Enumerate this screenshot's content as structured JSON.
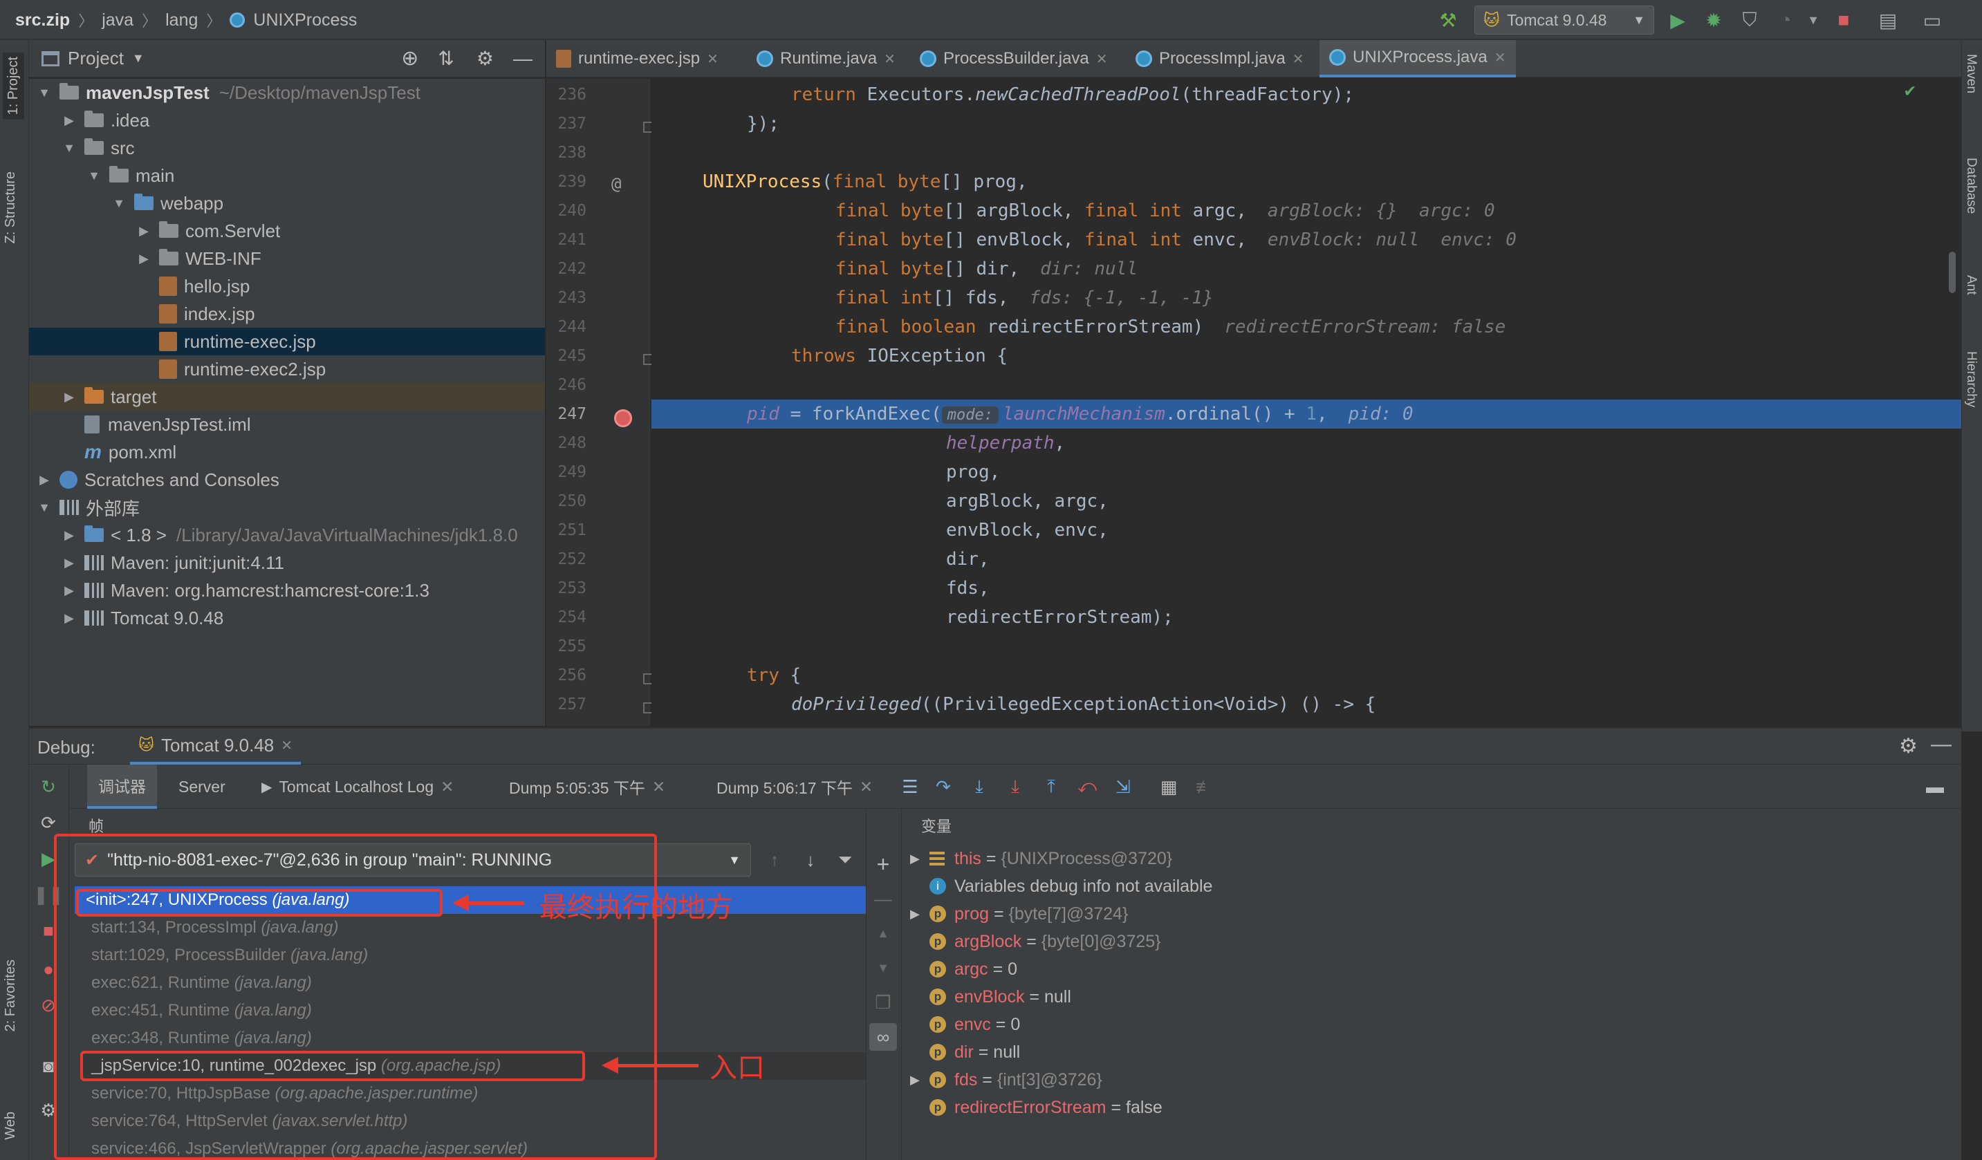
{
  "breadcrumbs": [
    "src.zip",
    "java",
    "lang",
    "UNIXProcess"
  ],
  "run_config": "Tomcat 9.0.48",
  "left_strip": {
    "project_tab": "1: Project",
    "structure_tab": "Z: Structure",
    "favorites_tab": "2: Favorites",
    "web_tab": "Web"
  },
  "right_strip": [
    "Maven",
    "Database",
    "Ant",
    "Hierarchy"
  ],
  "project": {
    "title": "Project",
    "tree": [
      {
        "label": "mavenJspTest",
        "path": "~/Desktop/mavenJspTest"
      },
      {
        "label": ".idea"
      },
      {
        "label": "src"
      },
      {
        "label": "main"
      },
      {
        "label": "webapp"
      },
      {
        "label": "com.Servlet"
      },
      {
        "label": "WEB-INF"
      },
      {
        "label": "hello.jsp"
      },
      {
        "label": "index.jsp"
      },
      {
        "label": "runtime-exec.jsp"
      },
      {
        "label": "runtime-exec2.jsp"
      },
      {
        "label": "target"
      },
      {
        "label": "mavenJspTest.iml"
      },
      {
        "label": "pom.xml"
      },
      {
        "label": "Scratches and Consoles"
      },
      {
        "label": "外部库"
      },
      {
        "label": "< 1.8 >",
        "path": "/Library/Java/JavaVirtualMachines/jdk1.8.0"
      },
      {
        "label": "Maven: junit:junit:4.11"
      },
      {
        "label": "Maven: org.hamcrest:hamcrest-core:1.3"
      },
      {
        "label": "Tomcat 9.0.48"
      }
    ]
  },
  "editor": {
    "tabs": [
      "runtime-exec.jsp",
      "Runtime.java",
      "ProcessBuilder.java",
      "ProcessImpl.java",
      "UNIXProcess.java"
    ],
    "active_tab": "UNIXProcess.java",
    "line_numbers": [
      "236",
      "237",
      "238",
      "239",
      "240",
      "241",
      "242",
      "243",
      "244",
      "245",
      "246",
      "247",
      "248",
      "249",
      "250",
      "251",
      "252",
      "253",
      "254",
      "255",
      "256",
      "257"
    ],
    "code": {
      "l236_kw": "return ",
      "l236_a": "Executors.",
      "l236_b": "newCachedThreadPool",
      "l236_c": "(threadFactory);",
      "l237": "});",
      "l239_fn": "UNIXProcess",
      "l239_a": "(",
      "l239_kw1": "final ",
      "l239_kw2": "byte",
      "l239_b": "[] prog,",
      "l240_kw1": "final ",
      "l240_kw2": "byte",
      "l240_a": "[] argBlock, ",
      "l240_kw3": "final ",
      "l240_kw4": "int",
      "l240_b": " argc,",
      "l240_hint": "argBlock: {}  argc: 0",
      "l241_kw1": "final ",
      "l241_kw2": "byte",
      "l241_a": "[] envBlock, ",
      "l241_kw3": "final ",
      "l241_kw4": "int",
      "l241_b": " envc,",
      "l241_hint": "envBlock: null  envc: 0",
      "l242_kw1": "final ",
      "l242_kw2": "byte",
      "l242_a": "[] dir,",
      "l242_hint": "dir: null",
      "l243_kw1": "final ",
      "l243_kw2": "int",
      "l243_a": "[] fds,",
      "l243_hint": "fds: {-1, -1, -1}",
      "l244_kw1": "final ",
      "l244_kw2": "boolean",
      "l244_a": " redirectErrorStream)",
      "l244_hint": "redirectErrorStream: false",
      "l245_kw": "throws ",
      "l245_a": "IOException {",
      "l247_a": "pid",
      "l247_b": " = forkAndExec(",
      "l247_chip": "mode:",
      "l247_c": "launchMechanism",
      "l247_d": ".ordinal() + ",
      "l247_num": "1",
      "l247_e": ",",
      "l247_hint": "pid: 0",
      "l248": "helperpath",
      "l248_b": ",",
      "l249": "prog,",
      "l250": "argBlock, argc,",
      "l251": "envBlock, envc,",
      "l252": "dir,",
      "l253": "fds,",
      "l254": "redirectErrorStream);",
      "l256_kw": "try ",
      "l256_a": "{",
      "l257_a": "doPrivileged",
      "l257_b": "((PrivilegedExceptionAction<Void>) () -> {"
    }
  },
  "debug": {
    "label": "Debug:",
    "session": "Tomcat 9.0.48",
    "tabs": [
      "调试器",
      "Server",
      "Tomcat Localhost Log",
      "Dump 5:05:35 下午",
      "Dump 5:06:17 下午"
    ],
    "frames_title": "帧",
    "vars_title": "变量",
    "thread": "\"http-nio-8081-exec-7\"@2,636 in group \"main\": RUNNING",
    "frames": [
      {
        "method": "<init>:247, UNIXProcess",
        "pkg": "(java.lang)"
      },
      {
        "method": "start:134, ProcessImpl",
        "pkg": "(java.lang)"
      },
      {
        "method": "start:1029, ProcessBuilder",
        "pkg": "(java.lang)"
      },
      {
        "method": "exec:621, Runtime",
        "pkg": "(java.lang)"
      },
      {
        "method": "exec:451, Runtime",
        "pkg": "(java.lang)"
      },
      {
        "method": "exec:348, Runtime",
        "pkg": "(java.lang)"
      },
      {
        "method": "_jspService:10, runtime_002dexec_jsp",
        "pkg": "(org.apache.jsp)"
      },
      {
        "method": "service:70, HttpJspBase",
        "pkg": "(org.apache.jasper.runtime)"
      },
      {
        "method": "service:764, HttpServlet",
        "pkg": "(javax.servlet.http)"
      },
      {
        "method": "service:466, JspServletWrapper",
        "pkg": "(org.apache.jasper.servlet)"
      }
    ],
    "variables": [
      {
        "name": "this",
        "eq": " = ",
        "value": "{UNIXProcess@3720}"
      },
      {
        "name": "",
        "eq": "",
        "value": "Variables debug info not available"
      },
      {
        "name": "prog",
        "eq": " = ",
        "value": "{byte[7]@3724}"
      },
      {
        "name": "argBlock",
        "eq": " = ",
        "value": "{byte[0]@3725}"
      },
      {
        "name": "argc",
        "eq": " = ",
        "value": "0"
      },
      {
        "name": "envBlock",
        "eq": " = ",
        "value": "null"
      },
      {
        "name": "envc",
        "eq": " = ",
        "value": "0"
      },
      {
        "name": "dir",
        "eq": " = ",
        "value": "null"
      },
      {
        "name": "fds",
        "eq": " = ",
        "value": "{int[3]@3726}"
      },
      {
        "name": "redirectErrorStream",
        "eq": " = ",
        "value": "false"
      }
    ],
    "annotation_exec": "最终执行的地方",
    "annotation_entry": "入口"
  },
  "colors": {
    "selection": "#2f65ca",
    "annotation": "#e8392e",
    "keyword": "#cc7832"
  }
}
